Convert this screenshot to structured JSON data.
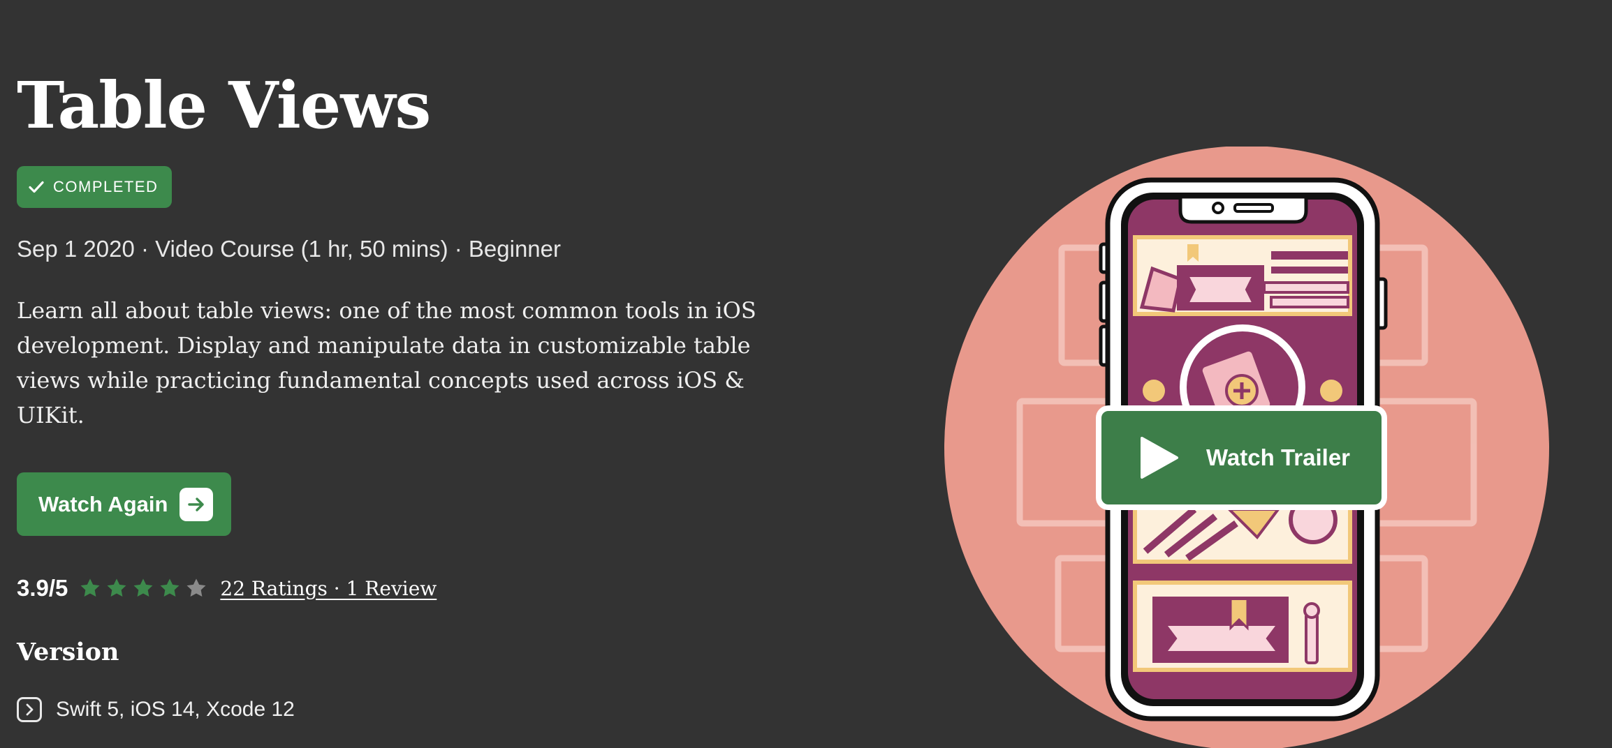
{
  "course": {
    "title": "Table Views",
    "status_badge": "COMPLETED",
    "meta": "Sep 1 2020 · Video Course (1 hr, 50 mins) · Beginner",
    "description": "Learn all about table views: one of the most common tools in iOS development. Display and manipulate data in customizable table views while practicing fundamental concepts used across iOS & UIKit."
  },
  "actions": {
    "watch_again_label": "Watch Again",
    "watch_trailer_label": "Watch Trailer"
  },
  "rating": {
    "value_text": "3.9/5",
    "stars_filled": 4,
    "stars_total": 5,
    "reviews_text": "22 Ratings · 1 Review"
  },
  "version": {
    "heading": "Version",
    "text": "Swift 5, iOS 14, Xcode 12"
  },
  "colors": {
    "background": "#333333",
    "accent_green": "#3d8a4c",
    "star_empty": "#8a8a8a",
    "art_circle": "#e8998c",
    "phone_screen": "#8e3766",
    "illustration_cream": "#fdf0dc"
  },
  "icons": {
    "badge": "checkmark-icon",
    "watch_again": "arrow-right-icon",
    "trailer": "play-icon",
    "version": "chevron-right-icon"
  }
}
